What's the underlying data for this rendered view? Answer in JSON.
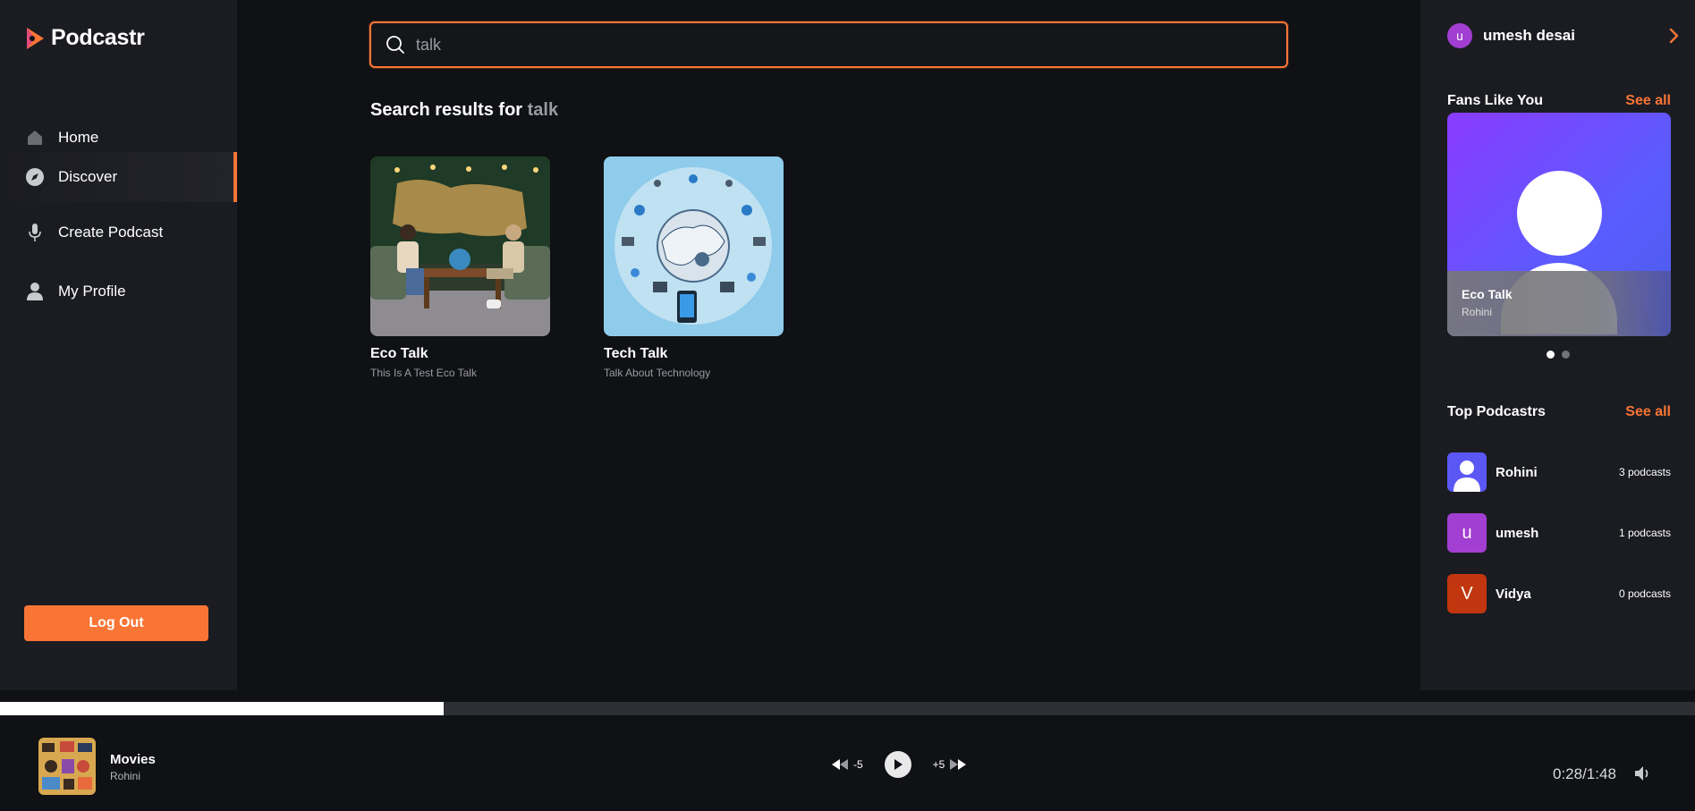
{
  "app": {
    "name": "Podcastr"
  },
  "nav": {
    "items": [
      {
        "label": "Home",
        "icon": "home-icon"
      },
      {
        "label": "Discover",
        "icon": "compass-icon",
        "active": true
      },
      {
        "label": "Create Podcast",
        "icon": "microphone-icon"
      },
      {
        "label": "My Profile",
        "icon": "user-icon"
      }
    ],
    "logout_label": "Log Out"
  },
  "search": {
    "value": "talk",
    "placeholder": ""
  },
  "results": {
    "prefix": "Search results for ",
    "term": "talk",
    "items": [
      {
        "title": "Eco Talk",
        "description": "This Is A Test Eco Talk"
      },
      {
        "title": "Tech Talk",
        "description": "Talk About Technology"
      }
    ]
  },
  "user": {
    "initial": "u",
    "name": "umesh desai"
  },
  "fans": {
    "title": "Fans Like You",
    "see_all": "See all",
    "card": {
      "title": "Eco Talk",
      "author": "Rohini"
    },
    "dots": 2,
    "active_dot": 0
  },
  "top_podcasters": {
    "title": "Top Podcastrs",
    "see_all": "See all",
    "items": [
      {
        "name": "Rohini",
        "count": "3 podcasts",
        "initial": "",
        "color": "#5b57f5"
      },
      {
        "name": "umesh",
        "count": "1 podcasts",
        "initial": "u",
        "color": "#a23ed1"
      },
      {
        "name": "Vidya",
        "count": "0 podcasts",
        "initial": "V",
        "color": "#c2360f"
      }
    ]
  },
  "player": {
    "title": "Movies",
    "author": "Rohini",
    "rewind_label": "-5",
    "forward_label": "+5",
    "time": "0:28/1:48",
    "progress": 0.262
  },
  "colors": {
    "accent": "#f97535",
    "bg": "#101114",
    "panel": "#1b1c21"
  }
}
